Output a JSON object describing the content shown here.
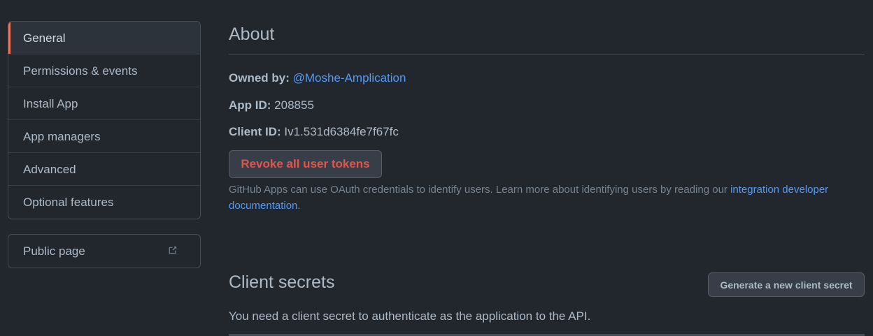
{
  "sidebar": {
    "items": [
      {
        "label": "General"
      },
      {
        "label": "Permissions & events"
      },
      {
        "label": "Install App"
      },
      {
        "label": "App managers"
      },
      {
        "label": "Advanced"
      },
      {
        "label": "Optional features"
      }
    ],
    "public_page": {
      "label": "Public page",
      "icon": "external-link-icon"
    }
  },
  "about": {
    "title": "About",
    "owned_by_label": "Owned by:",
    "owned_by_value": "@Moshe-Amplication",
    "app_id_label": "App ID:",
    "app_id_value": "208855",
    "client_id_label": "Client ID:",
    "client_id_value": "Iv1.531d6384fe7f67fc",
    "revoke_button": "Revoke all user tokens",
    "help_text": "GitHub Apps can use OAuth credentials to identify users. Learn more about identifying users by reading our ",
    "help_link": "integration developer documentation",
    "help_end": "."
  },
  "client_secrets": {
    "title": "Client secrets",
    "generate_button": "Generate a new client secret",
    "description": "You need a client secret to authenticate as the application to the API."
  },
  "colors": {
    "background": "#22272e",
    "selected_accent": "#ec775c",
    "link": "#539bf5",
    "danger": "#e5534b"
  }
}
